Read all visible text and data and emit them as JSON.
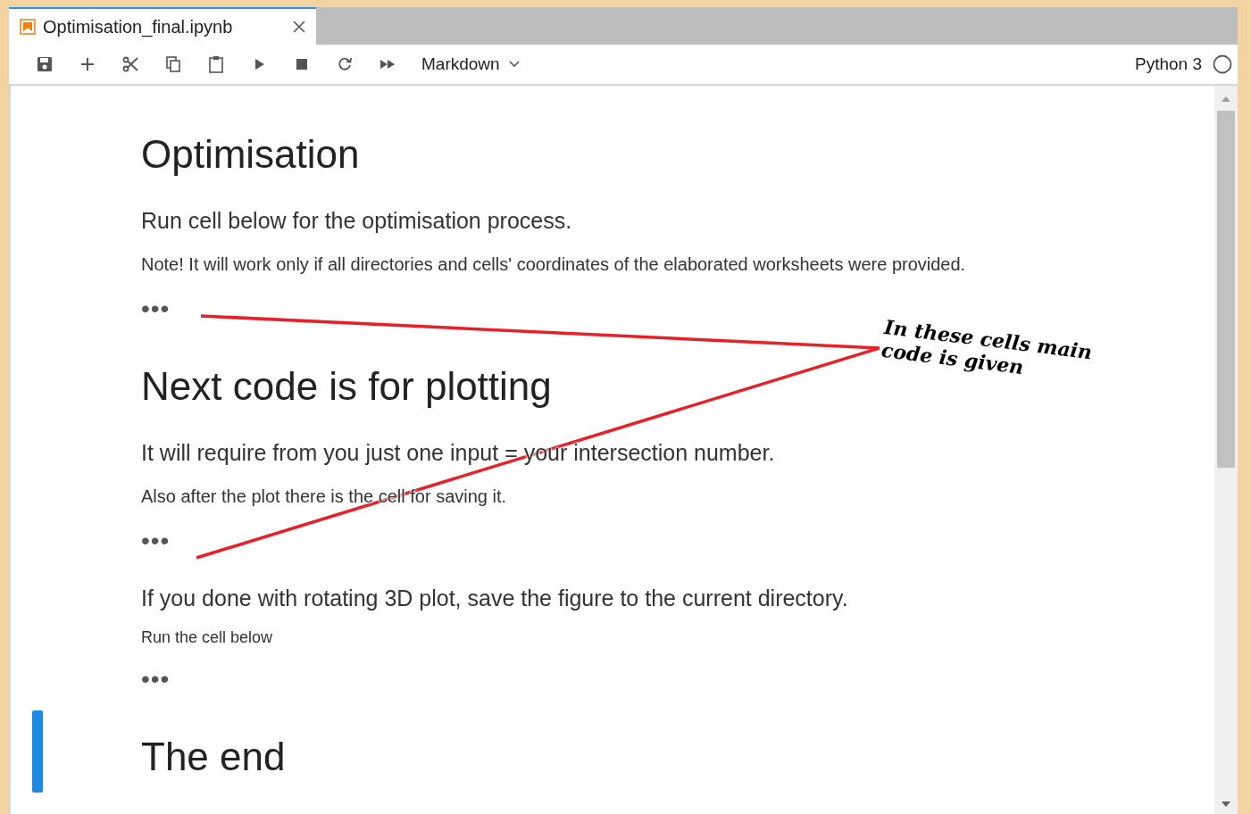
{
  "tabs": [
    {
      "title": "Optimisation_final.ipynb",
      "selected": true
    }
  ],
  "toolbar": {
    "cell_type": "Markdown",
    "kernel": "Python 3"
  },
  "cells": [
    {
      "selected": false,
      "items": [
        {
          "kind": "heading",
          "text": "Optimisation"
        },
        {
          "kind": "text",
          "text": "Run cell below for the optimisation process."
        },
        {
          "kind": "note",
          "text": "Note! It will work only if all directories and cells' coordinates of the elaborated worksheets were provided."
        },
        {
          "kind": "collapsed",
          "text": "•••"
        }
      ]
    },
    {
      "selected": false,
      "items": [
        {
          "kind": "heading",
          "text": "Next code is for plotting"
        },
        {
          "kind": "text",
          "text": "It will require from you just one input = your intersection number."
        },
        {
          "kind": "note",
          "text": "Also after the plot there is the cell for saving it."
        },
        {
          "kind": "collapsed",
          "text": "•••"
        }
      ]
    },
    {
      "selected": false,
      "items": [
        {
          "kind": "text",
          "text": "If you done with rotating 3D plot, save the figure to the current directory."
        },
        {
          "kind": "small",
          "text": "Run the cell below"
        },
        {
          "kind": "collapsed",
          "text": "•••"
        }
      ]
    },
    {
      "selected": true,
      "items": [
        {
          "kind": "heading",
          "text": "The end"
        }
      ]
    }
  ],
  "annotation": {
    "text": "In these cells main code is given"
  }
}
